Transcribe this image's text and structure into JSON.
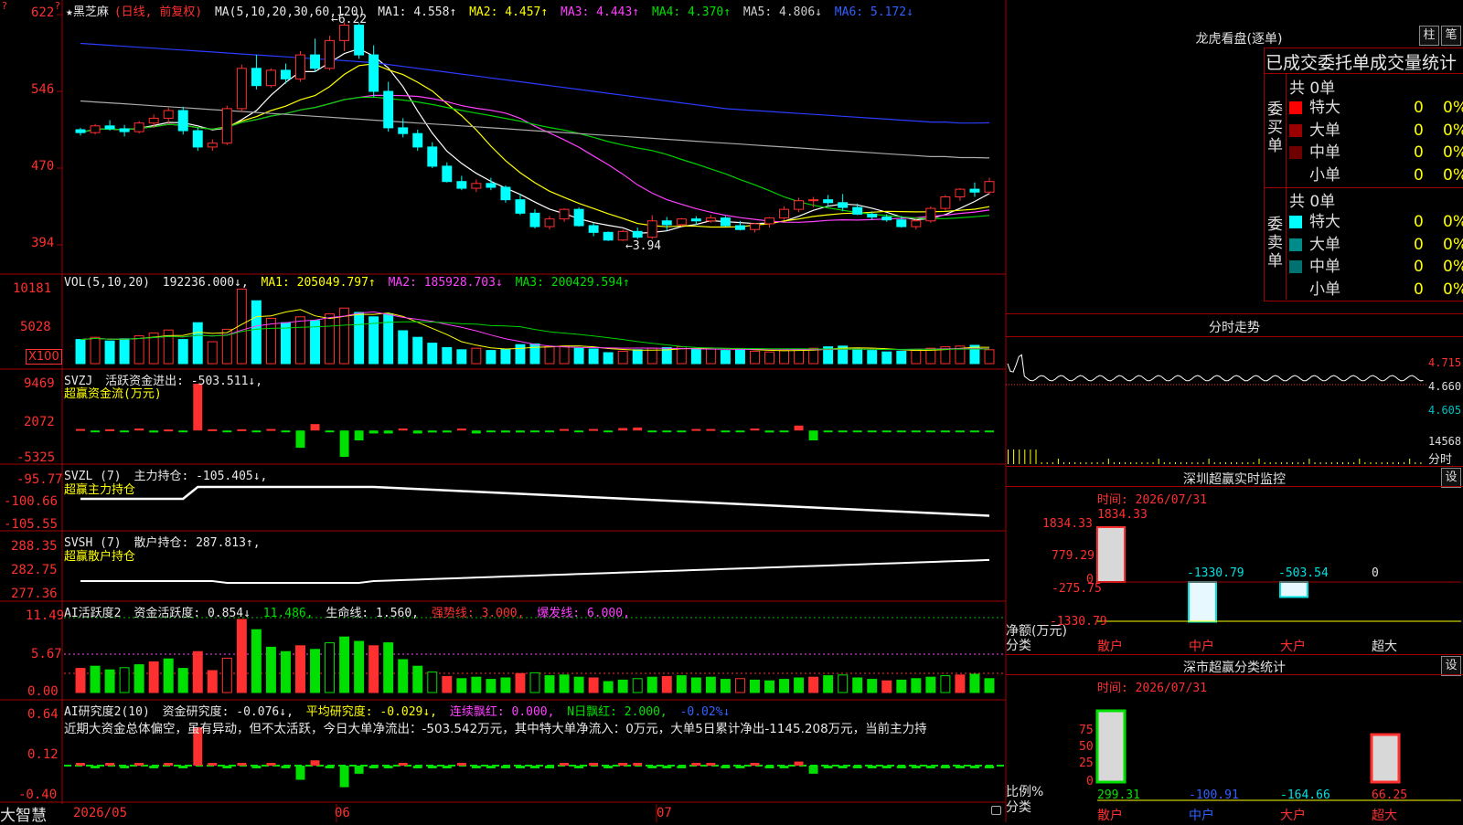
{
  "app": {
    "brand": "大智慧"
  },
  "main": {
    "header": {
      "star": "★",
      "name": "黑芝麻",
      "mode": "(日线, 前复权)",
      "ma_spec": "MA(5,10,20,30,60,120)",
      "ma1": "MA1: 4.558↑",
      "ma2": "MA2: 4.457↑",
      "ma3": "MA3: 4.443↑",
      "ma4": "MA4: 4.370↑",
      "ma5": "MA5: 4.806↓",
      "ma6": "MA6: 5.172↓"
    },
    "y_ticks": [
      "622",
      "546",
      "470",
      "394"
    ],
    "high_mark": "←6.22",
    "low_mark": "←3.94"
  },
  "vol": {
    "header": {
      "spec": "VOL(5,10,20)",
      "val": "192236.000↓,",
      "ma1": "MA1: 205049.797↑",
      "ma2": "MA2: 185928.703↓",
      "ma3": "MA3: 200429.594↑"
    },
    "y_ticks": [
      "10181",
      "5028"
    ],
    "unit": "X100"
  },
  "svzj": {
    "header": {
      "spec": "SVZJ",
      "label": "活跃资金进出: -503.511↓,",
      "sub": "超赢资金流(万元)"
    },
    "y_ticks": [
      "9469",
      "2072",
      "-5325"
    ]
  },
  "svzl": {
    "header": {
      "spec": "SVZL (7)",
      "label": "主力持仓: -105.405↓,",
      "sub": "超赢主力持仓"
    },
    "y_ticks": [
      "-95.77",
      "-100.66",
      "-105.55"
    ]
  },
  "svsh": {
    "header": {
      "spec": "SVSH (7)",
      "label": "散户持仓: 287.813↑,",
      "sub": "超赢散户持仓"
    },
    "y_ticks": [
      "288.35",
      "282.75",
      "277.36"
    ]
  },
  "ai1": {
    "header": {
      "spec": "AI活跃度2",
      "a": "资金活跃度: 0.854↓",
      "b": "11.486,",
      "c": "生命线: 1.560,",
      "d": "强势线: 3.000,",
      "e": "爆发线: 6.000,"
    },
    "y_ticks": [
      "11.49",
      "5.67",
      "0.00"
    ]
  },
  "ai2": {
    "header": {
      "spec": "AI研究度2(10)",
      "a": "资金研究度: -0.076↓,",
      "b": "平均研究度: -0.029↓,",
      "c": "连续飘红: 0.000,",
      "d": "N日飘红: 2.000,",
      "e": "-0.02%↓"
    },
    "comment": "近期大资金总体偏空，虽有异动，但不太活跃，今日大单净流出：-503.542万元，其中特大单净流入：0万元，大单5日累计净出-1145.208万元，当前主力持",
    "y_ticks": [
      "0.64",
      "0.12",
      "-0.40"
    ]
  },
  "xaxis": {
    "labels": [
      "2026/05",
      "06",
      "07"
    ]
  },
  "right": {
    "dragon": {
      "title": "龙虎看盘(逐单)",
      "btn_bar": "柱",
      "btn_pen": "笔",
      "table_title": "已成交委托单成交量统计",
      "buy": {
        "label": "委买单",
        "total": "共 0单",
        "rows": [
          {
            "name": "特大",
            "n": "0",
            "p": "0%",
            "color": "#ff0000"
          },
          {
            "name": "大单",
            "n": "0",
            "p": "0%",
            "color": "#9b0000"
          },
          {
            "name": "中单",
            "n": "0",
            "p": "0%",
            "color": "#6e0000"
          },
          {
            "name": "小单",
            "n": "0",
            "p": "0%",
            "color": "#000000"
          }
        ]
      },
      "sell": {
        "label": "委卖单",
        "total": "共 0单",
        "rows": [
          {
            "name": "特大",
            "n": "0",
            "p": "0%",
            "color": "#00ffff"
          },
          {
            "name": "大单",
            "n": "0",
            "p": "0%",
            "color": "#008b8b"
          },
          {
            "name": "中单",
            "n": "0",
            "p": "0%",
            "color": "#007070"
          },
          {
            "name": "小单",
            "n": "0",
            "p": "0%",
            "color": "#000000"
          }
        ]
      }
    },
    "intraday": {
      "title": "分时走势",
      "y_ticks": [
        "4.715",
        "4.660",
        "4.605"
      ],
      "vol_max": "14568",
      "vol_label": "分时"
    },
    "monitor": {
      "title": "深圳超赢实时监控",
      "btn": "设",
      "time": "时间: 2026/07/31",
      "y_ticks": [
        "1834.33",
        "779.29",
        "0",
        "-275.75",
        "-1330.79"
      ],
      "unit": "净额(万元)",
      "cat_label": "分类",
      "categories": [
        "散户",
        "中户",
        "大户",
        "超大"
      ],
      "values": [
        1834.33,
        -1330.79,
        -503.54,
        0
      ],
      "value_labels": [
        "1834.33",
        "-1330.79",
        "-503.54",
        "0"
      ]
    },
    "classify": {
      "title": "深市超赢分类统计",
      "btn": "设",
      "time": "时间: 2026/07/31",
      "y_ticks": [
        "75",
        "50",
        "25",
        "0"
      ],
      "unit": "比例%",
      "cat_label": "分类",
      "categories": [
        "散户",
        "中户",
        "大户",
        "超大"
      ],
      "value_labels": [
        "299.31",
        "-100.91",
        "-164.66",
        "66.25"
      ]
    }
  },
  "chart_data": {
    "type": "candlestick",
    "title": "黑芝麻 (日线, 前复权)",
    "ylim": [
      3.9,
      6.3
    ],
    "x_labels": [
      "2026/05",
      "06",
      "07"
    ],
    "ohlc": [
      [
        5.1,
        5.12,
        5.04,
        5.07
      ],
      [
        5.07,
        5.16,
        5.05,
        5.14
      ],
      [
        5.14,
        5.2,
        5.09,
        5.11
      ],
      [
        5.11,
        5.15,
        5.03,
        5.08
      ],
      [
        5.08,
        5.19,
        5.06,
        5.17
      ],
      [
        5.17,
        5.26,
        5.12,
        5.22
      ],
      [
        5.22,
        5.33,
        5.16,
        5.3
      ],
      [
        5.3,
        5.34,
        5.05,
        5.09
      ],
      [
        5.09,
        5.12,
        4.88,
        4.92
      ],
      [
        4.92,
        5.0,
        4.88,
        4.96
      ],
      [
        4.96,
        5.35,
        4.94,
        5.32
      ],
      [
        5.32,
        5.78,
        5.28,
        5.74
      ],
      [
        5.74,
        5.88,
        5.52,
        5.56
      ],
      [
        5.56,
        5.74,
        5.54,
        5.72
      ],
      [
        5.72,
        5.79,
        5.58,
        5.63
      ],
      [
        5.63,
        5.92,
        5.6,
        5.88
      ],
      [
        5.88,
        6.05,
        5.7,
        5.74
      ],
      [
        5.74,
        6.08,
        5.72,
        6.03
      ],
      [
        6.03,
        6.22,
        5.92,
        6.19
      ],
      [
        6.19,
        6.21,
        5.84,
        5.88
      ],
      [
        5.88,
        5.98,
        5.44,
        5.5
      ],
      [
        5.5,
        5.6,
        5.08,
        5.12
      ],
      [
        5.12,
        5.22,
        5.02,
        5.06
      ],
      [
        5.06,
        5.1,
        4.88,
        4.92
      ],
      [
        4.92,
        4.97,
        4.7,
        4.72
      ],
      [
        4.72,
        4.76,
        4.55,
        4.56
      ],
      [
        4.56,
        4.62,
        4.47,
        4.49
      ],
      [
        4.49,
        4.58,
        4.45,
        4.54
      ],
      [
        4.54,
        4.6,
        4.47,
        4.5
      ],
      [
        4.5,
        4.52,
        4.34,
        4.37
      ],
      [
        4.37,
        4.43,
        4.21,
        4.23
      ],
      [
        4.23,
        4.27,
        4.07,
        4.09
      ],
      [
        4.09,
        4.2,
        4.06,
        4.17
      ],
      [
        4.17,
        4.28,
        4.14,
        4.27
      ],
      [
        4.27,
        4.29,
        4.09,
        4.1
      ],
      [
        4.1,
        4.13,
        3.99,
        4.03
      ],
      [
        4.03,
        4.04,
        3.94,
        3.95
      ],
      [
        3.95,
        4.06,
        3.94,
        4.04
      ],
      [
        4.04,
        4.08,
        3.96,
        3.98
      ],
      [
        3.98,
        4.21,
        3.96,
        4.15
      ],
      [
        4.15,
        4.19,
        4.05,
        4.11
      ],
      [
        4.11,
        4.18,
        4.09,
        4.17
      ],
      [
        4.17,
        4.2,
        4.11,
        4.15
      ],
      [
        4.15,
        4.21,
        4.13,
        4.18
      ],
      [
        4.18,
        4.2,
        4.09,
        4.1
      ],
      [
        4.1,
        4.15,
        4.05,
        4.06
      ],
      [
        4.06,
        4.13,
        4.03,
        4.12
      ],
      [
        4.12,
        4.19,
        4.08,
        4.18
      ],
      [
        4.18,
        4.3,
        4.16,
        4.27
      ],
      [
        4.27,
        4.39,
        4.24,
        4.36
      ],
      [
        4.36,
        4.4,
        4.29,
        4.37
      ],
      [
        4.37,
        4.42,
        4.3,
        4.34
      ],
      [
        4.34,
        4.43,
        4.25,
        4.29
      ],
      [
        4.29,
        4.33,
        4.21,
        4.22
      ],
      [
        4.22,
        4.25,
        4.16,
        4.19
      ],
      [
        4.19,
        4.22,
        4.14,
        4.16
      ],
      [
        4.16,
        4.2,
        4.08,
        4.09
      ],
      [
        4.09,
        4.18,
        4.06,
        4.15
      ],
      [
        4.15,
        4.3,
        4.13,
        4.28
      ],
      [
        4.28,
        4.42,
        4.26,
        4.4
      ],
      [
        4.4,
        4.49,
        4.36,
        4.48
      ],
      [
        4.48,
        4.55,
        4.4,
        4.45
      ],
      [
        4.45,
        4.6,
        4.42,
        4.56
      ]
    ],
    "series": [
      {
        "name": "MA1",
        "color": "#ffffff"
      },
      {
        "name": "MA2",
        "color": "#ffff00"
      },
      {
        "name": "MA3",
        "color": "#ff40ff"
      },
      {
        "name": "MA4",
        "color": "#00d000"
      },
      {
        "name": "MA5",
        "color": "#aaaaaa",
        "values": [
          5.4,
          5.39,
          5.38,
          5.37,
          5.36,
          5.35,
          5.34,
          5.33,
          5.32,
          5.31,
          5.3,
          5.29,
          5.28,
          5.27,
          5.26,
          5.25,
          5.24,
          5.23,
          5.22,
          5.21,
          5.2,
          5.19,
          5.18,
          5.17,
          5.16,
          5.15,
          5.14,
          5.13,
          5.12,
          5.11,
          5.1,
          5.09,
          5.08,
          5.07,
          5.06,
          5.05,
          5.04,
          5.03,
          5.02,
          5.01,
          5.0,
          4.99,
          4.98,
          4.97,
          4.96,
          4.95,
          4.94,
          4.93,
          4.92,
          4.91,
          4.9,
          4.89,
          4.88,
          4.87,
          4.86,
          4.85,
          4.84,
          4.83,
          4.82,
          4.82,
          4.81,
          4.81,
          4.806
        ]
      },
      {
        "name": "MA6",
        "color": "#2a3cff",
        "values": [
          6.0,
          5.99,
          5.98,
          5.97,
          5.96,
          5.95,
          5.94,
          5.93,
          5.92,
          5.91,
          5.9,
          5.89,
          5.88,
          5.87,
          5.86,
          5.85,
          5.84,
          5.83,
          5.82,
          5.81,
          5.8,
          5.78,
          5.76,
          5.74,
          5.72,
          5.7,
          5.68,
          5.66,
          5.64,
          5.62,
          5.6,
          5.58,
          5.56,
          5.54,
          5.52,
          5.5,
          5.48,
          5.46,
          5.44,
          5.42,
          5.4,
          5.38,
          5.36,
          5.34,
          5.32,
          5.31,
          5.3,
          5.29,
          5.28,
          5.27,
          5.26,
          5.25,
          5.24,
          5.23,
          5.22,
          5.21,
          5.2,
          5.19,
          5.18,
          5.18,
          5.17,
          5.17,
          5.172
        ]
      }
    ],
    "volume": [
      330,
      360,
      310,
      340,
      380,
      420,
      460,
      330,
      560,
      300,
      470,
      1020,
      860,
      620,
      560,
      640,
      590,
      680,
      760,
      700,
      640,
      680,
      450,
      360,
      280,
      220,
      190,
      210,
      180,
      200,
      260,
      270,
      230,
      240,
      210,
      200,
      150,
      170,
      190,
      210,
      220,
      230,
      200,
      210,
      180,
      190,
      170,
      160,
      180,
      200,
      210,
      230,
      240,
      200,
      180,
      160,
      170,
      190,
      210,
      230,
      240,
      250,
      190
    ],
    "vol_ylim": [
      0,
      10181
    ],
    "flow": [
      300,
      -100,
      250,
      -200,
      400,
      -400,
      200,
      -300,
      9469,
      250,
      -250,
      250,
      -250,
      300,
      -300,
      -3500,
      1300,
      -300,
      -5325,
      -2000,
      -600,
      -600,
      400,
      -600,
      -400,
      -400,
      400,
      -600,
      -300,
      -400,
      -400,
      -300,
      -300,
      300,
      -300,
      300,
      -300,
      500,
      600,
      -300,
      -300,
      -300,
      300,
      300,
      -300,
      -300,
      400,
      -400,
      -300,
      1000,
      -2000,
      -300,
      -300,
      -300,
      -300,
      -300,
      -300,
      -300,
      -300,
      -300,
      -300,
      -300,
      -300
    ],
    "flow_ylim": [
      -5325,
      9469
    ]
  }
}
